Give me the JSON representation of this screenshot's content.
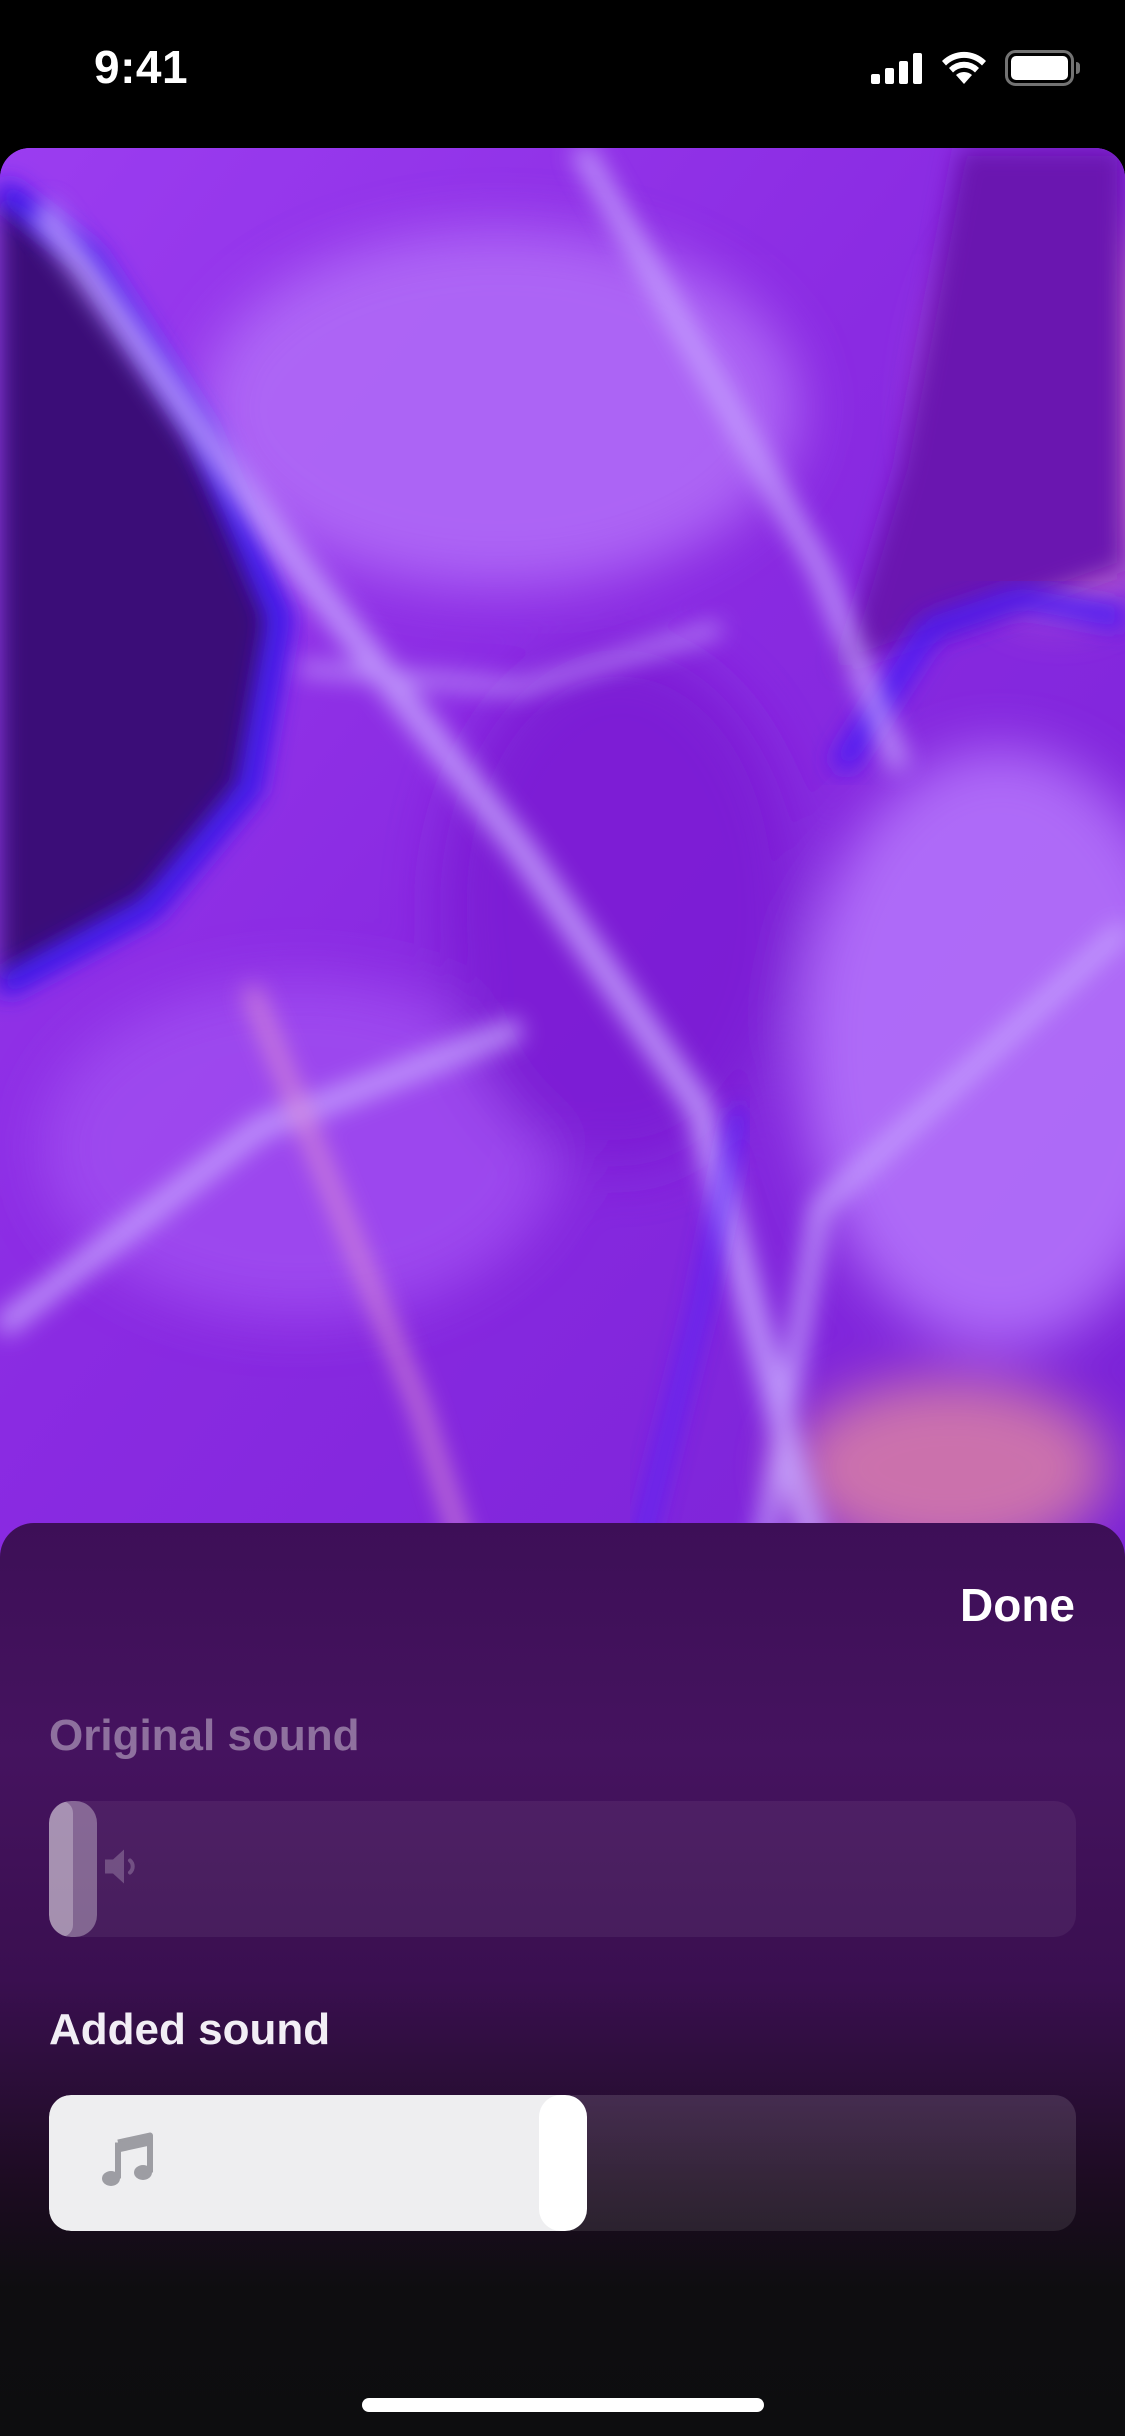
{
  "status_bar": {
    "time": "9:41",
    "icons": [
      "cellular-signal-icon",
      "wifi-icon",
      "battery-icon"
    ]
  },
  "video": {
    "dominant_color": "#8a2be2",
    "accent_colors": [
      "#b46cff",
      "#4b00c8",
      "#2a0a6e",
      "#e28aa6"
    ]
  },
  "sheet": {
    "done_label": "Done",
    "original_sound": {
      "label": "Original sound",
      "icon": "speaker-icon",
      "volume_fraction": 0.0
    },
    "added_sound": {
      "label": "Added sound",
      "icon": "music-note-icon",
      "volume_fraction": 0.5
    }
  },
  "colors": {
    "sheet_top": "#3d0f57",
    "sheet_bottom": "#0d0d0f",
    "slider_fill": "#eeeef0"
  }
}
